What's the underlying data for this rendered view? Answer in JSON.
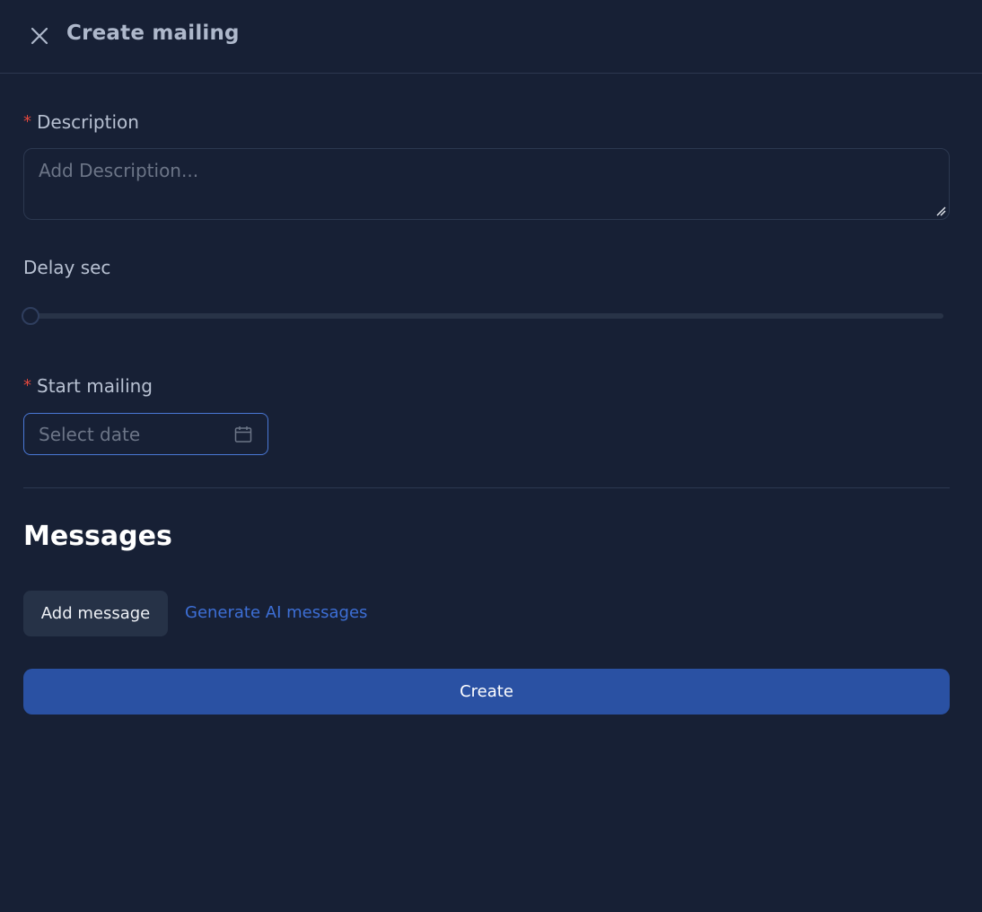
{
  "header": {
    "title": "Create mailing",
    "close_icon": "close-icon"
  },
  "description": {
    "label": "Description",
    "required_mark": "*",
    "value": "",
    "placeholder": "Add Description..."
  },
  "delay": {
    "label": "Delay sec",
    "value_fraction": 0
  },
  "start_mailing": {
    "label": "Start mailing",
    "required_mark": "*",
    "value": "",
    "placeholder": "Select date",
    "icon": "calendar-icon"
  },
  "messages": {
    "title": "Messages",
    "add_button": "Add message",
    "ai_link": "Generate AI messages"
  },
  "footer": {
    "create_button": "Create"
  },
  "colors": {
    "background": "#172035",
    "accent": "#2a51a3",
    "link": "#3d6fd6",
    "required": "#e0473d"
  }
}
